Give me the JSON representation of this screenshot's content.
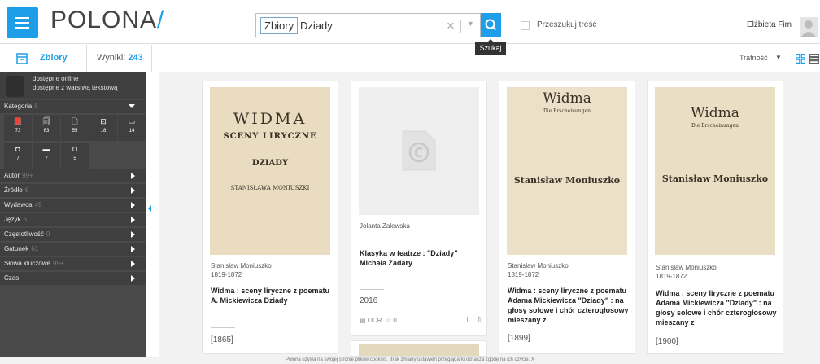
{
  "header": {
    "logo_text": "POLONA",
    "logo_slash": "/",
    "search": {
      "chip": "Zbiory",
      "value": "Dziady"
    },
    "search_tooltip": "Szukaj",
    "fulltext_label": "Przeszukuj treść",
    "user_name": "Elżbieta Fim"
  },
  "toolbar": {
    "collection_label": "Zbiory",
    "results_label": "Wyniki:",
    "results_count": "243",
    "sort_label": "Trafność"
  },
  "sidebar": {
    "online_label": "dostępne online",
    "text_layer_label": "dostępne z warstwą tekstową",
    "category_label": "Kategoria",
    "category_count": "8",
    "tiles": [
      {
        "icon": "book-icon",
        "glyph": "📕",
        "count": "73"
      },
      {
        "icon": "newspaper-icon",
        "glyph": "🗐",
        "count": "63"
      },
      {
        "icon": "document-icon",
        "glyph": "🗋",
        "count": "55"
      },
      {
        "icon": "picture-icon",
        "glyph": "⊡",
        "count": "18"
      },
      {
        "icon": "map-icon",
        "glyph": "▭",
        "count": "14"
      },
      {
        "icon": "sheet-music-icon",
        "glyph": "◘",
        "count": "7"
      },
      {
        "icon": "card-icon",
        "glyph": "▬",
        "count": "7"
      },
      {
        "icon": "scroll-icon",
        "glyph": "⊓",
        "count": "5"
      }
    ],
    "facets": [
      {
        "label": "Autor",
        "count": "99+"
      },
      {
        "label": "Źródło",
        "count": "6"
      },
      {
        "label": "Wydawca",
        "count": "49"
      },
      {
        "label": "Język",
        "count": "6"
      },
      {
        "label": "Częstotliwość",
        "count": "0"
      },
      {
        "label": "Gatunek",
        "count": "61"
      },
      {
        "label": "Słowa kluczowe",
        "count": "99+"
      },
      {
        "label": "Czas",
        "count": ""
      }
    ]
  },
  "results": [
    {
      "cover": "WIDMA",
      "cover_sub": "SCENY LIRYCZNE",
      "cover_extra": "DZIADY",
      "cover_author": "STANISŁAWA MONIUSZKI",
      "author": "Stanisław Moniuszko",
      "dates": "1819-1872",
      "title": "Widma : sceny liryczne z poematu A. Mickiewicza Dziady",
      "year": "[1865]"
    },
    {
      "author": "Jolanta Zalewska",
      "title": "Klasyka w teatrze : \"Dziady\" Michała Zadary",
      "year": "2016",
      "ocr": "OCR",
      "stars": "☆ 0"
    },
    {
      "cover": "Widma",
      "cover_sub": "Die Erscheinungen",
      "cover_extra": "Stanisław Moniuszko",
      "author": "Stanisław Moniuszko",
      "dates": "1819-1872",
      "title": "Widma : sceny liryczne z poematu Adama Mickiewicza \"Dziady\" : na głosy solowe i chór czterogłosowy mieszany z",
      "year": "[1899]"
    },
    {
      "cover": "Widma",
      "cover_sub": "Die Erscheinungen",
      "cover_extra": "Stanisław Moniuszko",
      "author": "Stanisław Moniuszko",
      "dates": "1819-1872",
      "title": "Widma : sceny liryczne z poematu Adama Mickiewicza \"Dziady\" : na głosy solowe i chór czterogłosowy mieszany z",
      "year": "[1900]"
    }
  ],
  "cookie_text": "Polona używa na swojej stronie plików cookies. Brak zmiany ustawień przeglądarki oznacza zgodę na ich użycie. X",
  "colors": {
    "accent": "#1e9ee8",
    "sidebar": "#4a4a4a"
  }
}
